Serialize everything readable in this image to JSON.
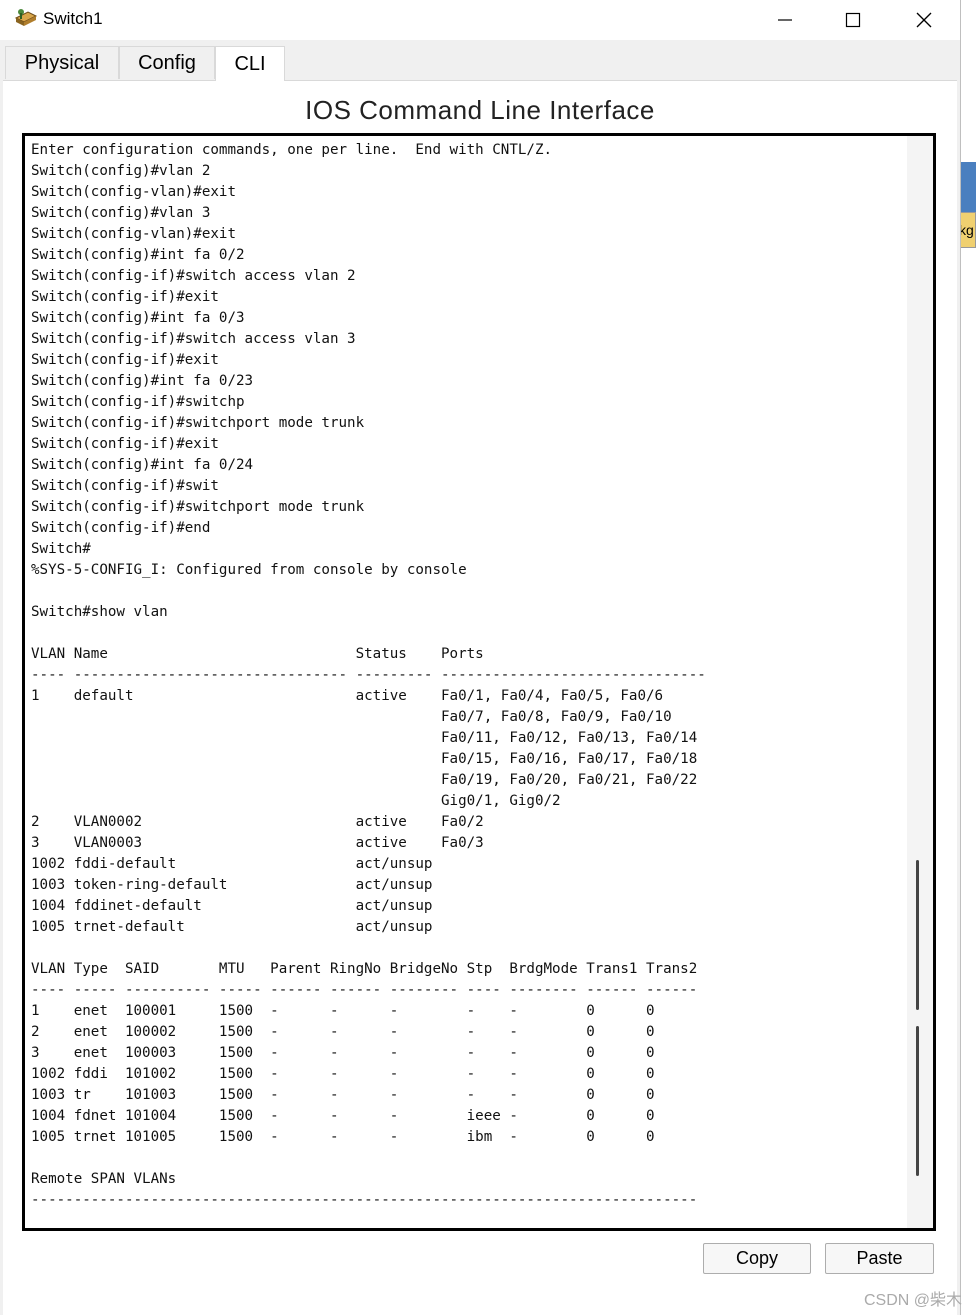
{
  "window": {
    "title": "Switch1",
    "tabs": [
      {
        "label": "Physical"
      },
      {
        "label": "Config"
      },
      {
        "label": "CLI"
      }
    ],
    "active_tab": "CLI"
  },
  "cli": {
    "heading": "IOS Command Line Interface",
    "lines": [
      "Enter configuration commands, one per line.  End with CNTL/Z.",
      "Switch(config)#vlan 2",
      "Switch(config-vlan)#exit",
      "Switch(config)#vlan 3",
      "Switch(config-vlan)#exit",
      "Switch(config)#int fa 0/2",
      "Switch(config-if)#switch access vlan 2",
      "Switch(config-if)#exit",
      "Switch(config)#int fa 0/3",
      "Switch(config-if)#switch access vlan 3",
      "Switch(config-if)#exit",
      "Switch(config)#int fa 0/23",
      "Switch(config-if)#switchp",
      "Switch(config-if)#switchport mode trunk",
      "Switch(config-if)#exit",
      "Switch(config)#int fa 0/24",
      "Switch(config-if)#swit",
      "Switch(config-if)#switchport mode trunk",
      "Switch(config-if)#end",
      "Switch#",
      "%SYS-5-CONFIG_I: Configured from console by console",
      "",
      "Switch#show vlan",
      "",
      "VLAN Name                             Status    Ports",
      "---- -------------------------------- --------- -------------------------------",
      "1    default                          active    Fa0/1, Fa0/4, Fa0/5, Fa0/6",
      "                                                Fa0/7, Fa0/8, Fa0/9, Fa0/10",
      "                                                Fa0/11, Fa0/12, Fa0/13, Fa0/14",
      "                                                Fa0/15, Fa0/16, Fa0/17, Fa0/18",
      "                                                Fa0/19, Fa0/20, Fa0/21, Fa0/22",
      "                                                Gig0/1, Gig0/2",
      "2    VLAN0002                         active    Fa0/2",
      "3    VLAN0003                         active    Fa0/3",
      "1002 fddi-default                     act/unsup",
      "1003 token-ring-default               act/unsup",
      "1004 fddinet-default                  act/unsup",
      "1005 trnet-default                    act/unsup",
      "",
      "VLAN Type  SAID       MTU   Parent RingNo BridgeNo Stp  BrdgMode Trans1 Trans2",
      "---- ----- ---------- ----- ------ ------ -------- ---- -------- ------ ------",
      "1    enet  100001     1500  -      -      -        -    -        0      0",
      "2    enet  100002     1500  -      -      -        -    -        0      0",
      "3    enet  100003     1500  -      -      -        -    -        0      0",
      "1002 fddi  101002     1500  -      -      -        -    -        0      0",
      "1003 tr    101003     1500  -      -      -        -    -        0      0",
      "1004 fdnet 101004     1500  -      -      -        ieee -        0      0",
      "1005 trnet 101005     1500  -      -      -        ibm  -        0      0",
      "",
      "Remote SPAN VLANs",
      "------------------------------------------------------------------------------"
    ]
  },
  "buttons": {
    "copy": "Copy",
    "paste": "Paste"
  },
  "background": {
    "side_label": "kg"
  },
  "watermark": "CSDN @柴木",
  "icons": {
    "app": "switch-device-icon",
    "minimize": "minimize-icon",
    "maximize": "maximize-icon",
    "close": "close-icon"
  }
}
